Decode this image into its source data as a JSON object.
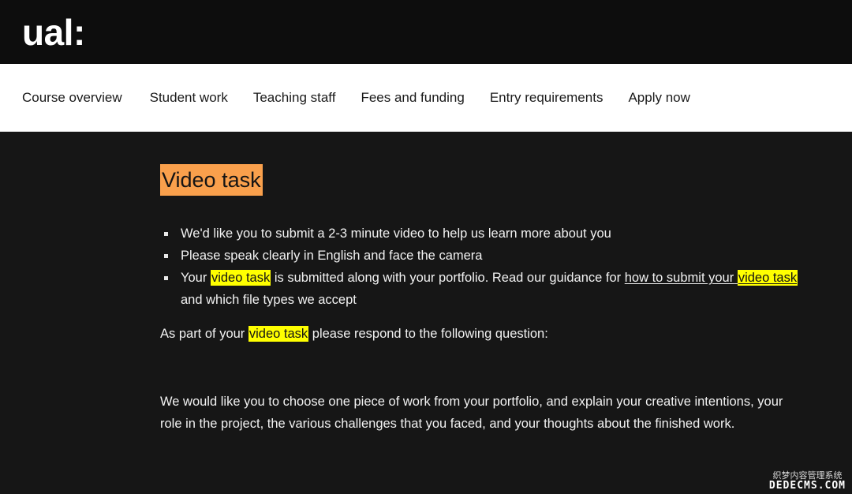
{
  "colors": {
    "header_bg": "#0d0d0d",
    "nav_bg": "#ffffff",
    "content_bg": "#161616",
    "title_highlight": "#f9a04c",
    "text_highlight": "#ffff00",
    "body_text": "#f2f2f2",
    "nav_text": "#1a1a1a"
  },
  "header": {
    "logo": "ual:"
  },
  "nav": {
    "items": [
      {
        "label": "Course overview"
      },
      {
        "label": "Student work"
      },
      {
        "label": "Teaching staff"
      },
      {
        "label": "Fees and funding"
      },
      {
        "label": "Entry requirements"
      },
      {
        "label": "Apply now"
      }
    ]
  },
  "main": {
    "title": "Video task",
    "bullets": [
      {
        "segments": [
          {
            "type": "text",
            "text": "We'd like you to submit a 2-3 minute video to help us learn more about you"
          }
        ]
      },
      {
        "segments": [
          {
            "type": "text",
            "text": "Please speak clearly in English and face the camera"
          }
        ]
      },
      {
        "segments": [
          {
            "type": "text",
            "text": "Your "
          },
          {
            "type": "highlight",
            "text": "video task"
          },
          {
            "type": "text",
            "text": " is submitted along with your portfolio. Read our guidance for "
          },
          {
            "type": "link",
            "text": "how to submit your"
          },
          {
            "type": "link-highlight",
            "text": "video task"
          },
          {
            "type": "text",
            "text": " and which file types we accept"
          }
        ]
      }
    ],
    "question_intro": {
      "before": "As part of your ",
      "highlight": "video task",
      "after": " please respond to the following question:"
    },
    "body_paragraph": "We would like you to choose one piece of work from your portfolio, and explain your creative intentions, your role in the project, the various challenges that you faced, and your thoughts about the finished work."
  },
  "watermark": {
    "chinese": "织梦内容管理系统",
    "latin": "DEDECMS.COM"
  }
}
